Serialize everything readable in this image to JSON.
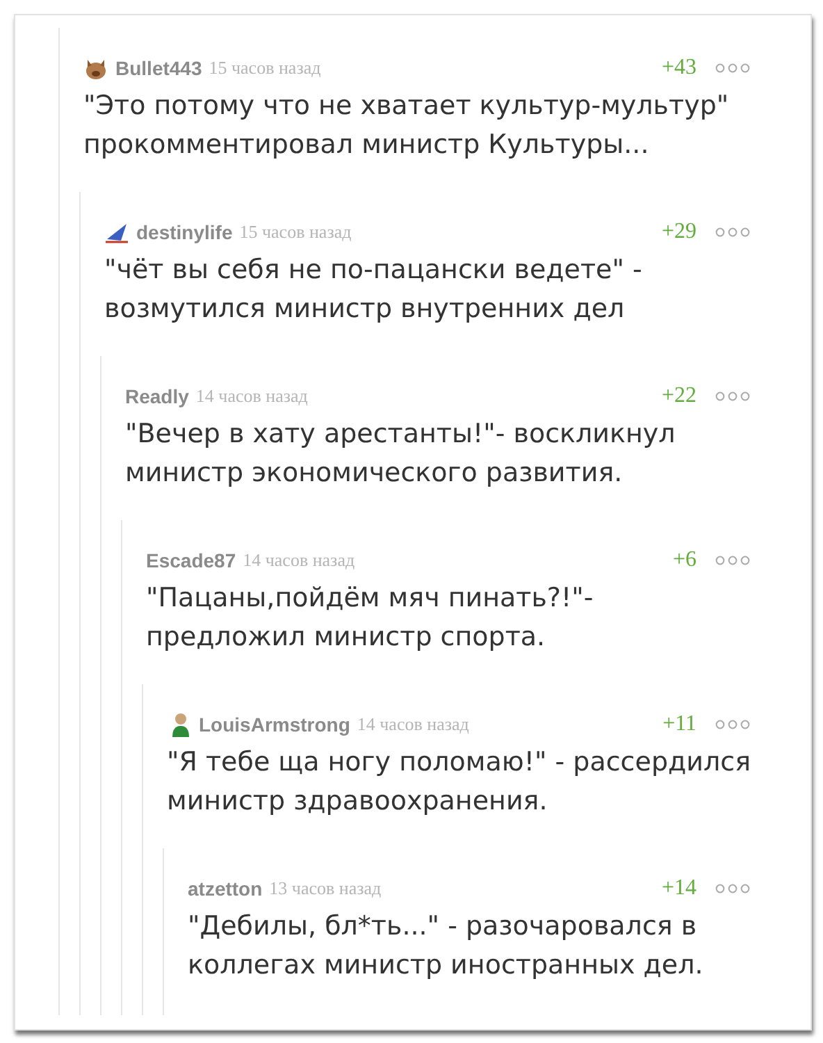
{
  "comments": [
    {
      "user": "Bullet443",
      "avatar": {
        "kind": "animal"
      },
      "time": "15 часов назад",
      "score": "+43",
      "text": "\"Это потому что не хватает культур-мультур\" прокомментировал министр Культуры...",
      "children": [
        {
          "user": "destinylife",
          "avatar": {
            "kind": "plane"
          },
          "time": "15 часов назад",
          "score": "+29",
          "text": "\"чёт вы себя не по-пацански ведете\" - возмутился министр внутренних дел",
          "children": [
            {
              "user": "Readly",
              "time": "14 часов назад",
              "score": "+22",
              "text": "\"Вечер в хату арестанты!\"- воскликнул министр экономического развития.",
              "children": [
                {
                  "user": "Escade87",
                  "time": "14 часов назад",
                  "score": "+6",
                  "text": "\"Пацаны,пойдём мяч пинать?!\"- предложил министр спорта.",
                  "children": [
                    {
                      "user": "LouisArmstrong",
                      "avatar": {
                        "kind": "figure"
                      },
                      "time": "14 часов назад",
                      "score": "+11",
                      "text": "\"Я тебе ща ногу поломаю!\" - рассердился министр здравоохранения.",
                      "children": [
                        {
                          "user": "atzetton",
                          "time": "13 часов назад",
                          "score": "+14",
                          "text": "\"Дебилы, бл*ть...\" - разочаровался в коллегах министр иностранных дел."
                        }
                      ]
                    }
                  ]
                }
              ]
            }
          ]
        }
      ]
    }
  ]
}
